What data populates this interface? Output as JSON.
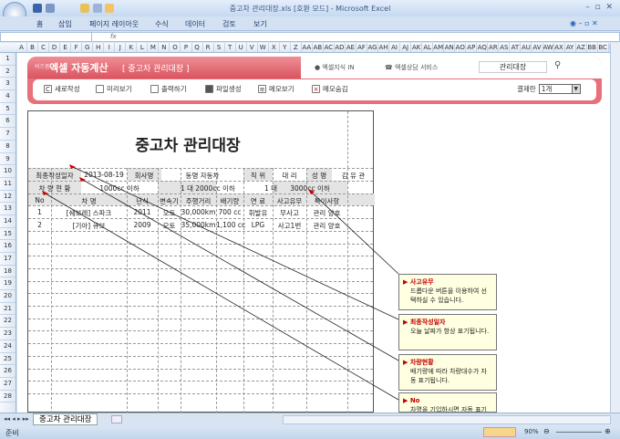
{
  "window": {
    "title": "중고차 관리대장.xls [호환 모드] - Microsoft Excel"
  },
  "ribbon_tabs": [
    "홈",
    "삽입",
    "페이지 레이아웃",
    "수식",
    "데이터",
    "검토",
    "보기"
  ],
  "formula_bar": {
    "name_box": "",
    "fx": "fx"
  },
  "columns": [
    "A",
    "B",
    "C",
    "D",
    "E",
    "F",
    "G",
    "H",
    "I",
    "J",
    "K",
    "L",
    "M",
    "N",
    "O",
    "P",
    "Q",
    "R",
    "S",
    "T",
    "U",
    "V",
    "W",
    "X",
    "Y",
    "Z",
    "AA",
    "AB",
    "AC",
    "AD",
    "AE",
    "AF",
    "AG",
    "AH",
    "AI",
    "AJ",
    "AK",
    "AL",
    "AM",
    "AN",
    "AO",
    "AP",
    "AQ",
    "AR",
    "AS",
    "AT",
    "AU",
    "AV",
    "AW",
    "AX",
    "AY",
    "AZ",
    "BB",
    "BC",
    "BD"
  ],
  "rows": [
    "1",
    "2",
    "3",
    "4",
    "5",
    "6",
    "7",
    "8",
    "9",
    "10",
    "11",
    "12",
    "13",
    "14",
    "15",
    "16",
    "17",
    "18",
    "19",
    "20",
    "21",
    "22",
    "23",
    "24",
    "25",
    "26",
    "27",
    "28"
  ],
  "banner": {
    "brand_small": "비즈폼",
    "brand": "엑셀 자동계산",
    "subtitle": "[ 중고차 관리대장 ]",
    "tab1": "엑셀지식 IN",
    "tab2": "엑셀상담 서비스",
    "search_value": "관리대장",
    "buttons": [
      "새로작성",
      "미리보기",
      "출력하기",
      "파일생성",
      "메모보기",
      "메모숨김"
    ],
    "payment_label": "결제란",
    "payment_value": "1개"
  },
  "sheet": {
    "title": "중고차 관리대장",
    "info": {
      "date_label": "최종작성일자",
      "date": "2013-08-19",
      "company_label": "회사명",
      "company": "동명 자동차",
      "position_label": "직  위",
      "position": "대 리",
      "name_label": "성  명",
      "name": "김 유 관"
    },
    "status": {
      "label": "차 량 현 황",
      "c1": "1000cc 이하",
      "v1": "1 대",
      "c2": "2000cc 이하",
      "v2": "1 대",
      "c3": "3000cc 이하"
    },
    "headers": [
      "No",
      "차  명",
      "년식",
      "변속기",
      "주행거리",
      "배기량",
      "연  료",
      "사고유무",
      "특이사항"
    ],
    "rows": [
      [
        "1",
        "[쉐보레] 스파크",
        "2011",
        "오토",
        "30,000km",
        "700 cc",
        "휘발유",
        "무사고",
        "관리 양호"
      ],
      [
        "2",
        "[기아] 큐브",
        "2009",
        "오토",
        "35,000km",
        "1,100 cc",
        "LPG",
        "사고1번",
        "관리 양호"
      ]
    ]
  },
  "notes": [
    {
      "title": "사고유무",
      "body": "드롭다운 버튼을 이용하여 선택하실 수 있습니다."
    },
    {
      "title": "최종작성일자",
      "body": "오늘 날짜가 항상 표기됩니다."
    },
    {
      "title": "차량현황",
      "body": "배기량에 따라 차량대수가 자동 표기됩니다."
    },
    {
      "title": "No",
      "body": "차명을 기입하시면 자동 표기됩니다."
    }
  ],
  "sheet_tab": "중고차 관리대장",
  "status_bar": {
    "ready": "준비",
    "zoom": "90%"
  },
  "colors": {
    "accent": "#d95560",
    "note_bg": "#ffffe1"
  }
}
